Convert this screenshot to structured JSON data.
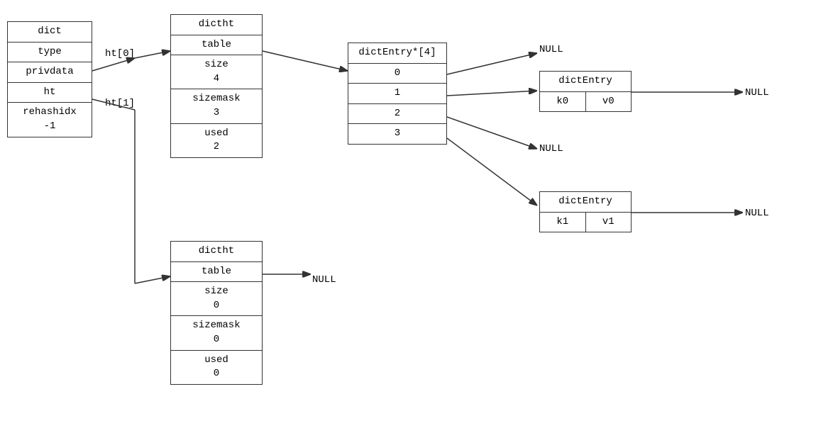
{
  "dict_box": {
    "title": "dict",
    "cells": [
      "dict",
      "type",
      "privdata",
      "ht",
      "rehashidx\n-1"
    ]
  },
  "ht_labels": {
    "ht0": "ht[0]",
    "ht1": "ht[1]"
  },
  "dictht_top": {
    "cells": [
      "dictht",
      "table",
      "size\n4",
      "sizemask\n3",
      "used\n2"
    ]
  },
  "dictht_bottom": {
    "cells": [
      "dictht",
      "table",
      "size\n0",
      "sizemask\n0",
      "used\n0"
    ]
  },
  "array_box": {
    "title": "dictEntry*[4]",
    "cells": [
      "dictEntry*[4]",
      "0",
      "1",
      "2",
      "3"
    ]
  },
  "entry_top": {
    "cells": [
      "dictEntry",
      "k0",
      "v0"
    ]
  },
  "entry_bottom": {
    "cells": [
      "dictEntry",
      "k1",
      "v1"
    ]
  },
  "null_labels": {
    "null1": "NULL",
    "null2": "NULL",
    "null3": "NULL",
    "null4": "NULL",
    "null5": "NULL"
  }
}
